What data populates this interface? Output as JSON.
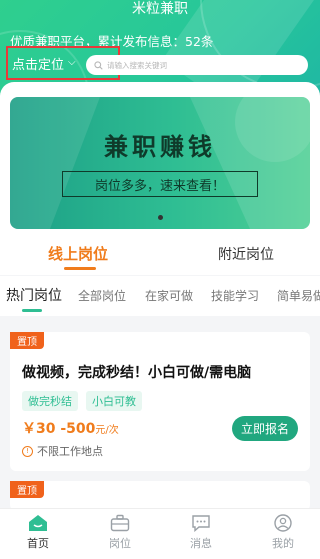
{
  "header": {
    "app_title": "米粒兼职",
    "subtitle": "优质兼职平台，累计发布信息：52条",
    "location_label": "点击定位",
    "search_placeholder": "请输入搜索关键词"
  },
  "banner": {
    "title": "兼职赚钱",
    "subtitle": "岗位多多，速来查看！"
  },
  "main_tabs": [
    {
      "label": "线上岗位",
      "active": true
    },
    {
      "label": "附近岗位",
      "active": false
    }
  ],
  "categories": [
    {
      "label": "热门岗位",
      "active": true
    },
    {
      "label": "全部岗位",
      "active": false
    },
    {
      "label": "在家可做",
      "active": false
    },
    {
      "label": "技能学习",
      "active": false
    },
    {
      "label": "简单易做",
      "active": false
    }
  ],
  "job_card": {
    "badge": "置顶",
    "title": "做视频，完成秒结！小白可做/需电脑",
    "tags": [
      "做完秒结",
      "小白可教"
    ],
    "price": "￥30 -500",
    "price_unit": "元/次",
    "apply_label": "立即报名",
    "location": "不限工作地点"
  },
  "job_card2": {
    "badge": "置顶"
  },
  "tabbar": [
    {
      "label": "首页",
      "icon": "home-icon",
      "active": true
    },
    {
      "label": "岗位",
      "icon": "briefcase-icon",
      "active": false
    },
    {
      "label": "消息",
      "icon": "chat-icon",
      "active": false
    },
    {
      "label": "我的",
      "icon": "user-icon",
      "active": false
    }
  ],
  "colors": {
    "primary": "#2fbe93",
    "accent": "#f07c1c",
    "pin": "#f0621b",
    "highlight_border": "#e8393a"
  }
}
